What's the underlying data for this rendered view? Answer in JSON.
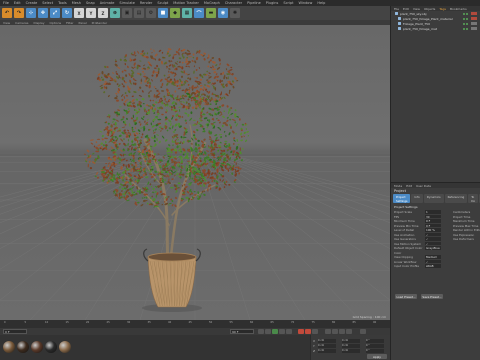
{
  "menubar": {
    "items": [
      "File",
      "Edit",
      "Create",
      "Select",
      "Tools",
      "Mesh",
      "Snap",
      "Animate",
      "Simulate",
      "Render",
      "Sculpt",
      "Motion Tracker",
      "MoGraph",
      "Character",
      "Pipeline",
      "Plugins",
      "Script",
      "Window",
      "Help"
    ]
  },
  "viewport": {
    "menus": [
      "View",
      "Cameras",
      "Display",
      "Options",
      "Filter",
      "Panel",
      "ProRender"
    ],
    "status": "Grid Spacing : 100 cm"
  },
  "object_manager": {
    "tabs": [
      "File",
      "Edit",
      "View",
      "Objects",
      "Tags",
      "Bookmarks"
    ],
    "active_tab": "Tags",
    "objects": [
      {
        "name": "plant_750_sky.obj",
        "tag_color": "#b24a3c"
      },
      {
        "name": "plant_750_foliage_Plant_material",
        "tag_color": "#b24a3c"
      },
      {
        "name": "Foliage_Plant_750",
        "tag_color": "#777777"
      },
      {
        "name": "plant_750_foliage_mat",
        "tag_color": "#777777"
      }
    ]
  },
  "attribute_manager": {
    "menus": [
      "Mode",
      "Edit",
      "User Data"
    ],
    "title": "Project",
    "tabs": [
      "Project Settings",
      "Info",
      "Dynamics",
      "Referencing",
      "To Do",
      "Key Interpolation"
    ],
    "section": "Project Settings",
    "rows": [
      {
        "label": "Project Scale",
        "value": "1",
        "right": "Centimeters"
      },
      {
        "label": "FPS",
        "value": "30",
        "right": "Project Time"
      },
      {
        "label": "Minimum Time",
        "value": "0 F",
        "right": "Maximum Time"
      },
      {
        "label": "Preview Min Time",
        "value": "0 F",
        "right": "Preview Max Time"
      },
      {
        "label": "Level of Detail",
        "value": "100 %",
        "right": "Render LOD in Editor"
      },
      {
        "label": "Use Animation",
        "value": "✓",
        "right": "Use Expression"
      },
      {
        "label": "Use Generators",
        "value": "✓",
        "right": "Use Deformers"
      },
      {
        "label": "Use Motion System",
        "value": "✓",
        "right": ""
      },
      {
        "label": "Default Object Color",
        "value": "Gray-Blue",
        "right": ""
      },
      {
        "label": "Color",
        "value": "",
        "right": ""
      },
      {
        "label": "View Clipping",
        "value": "Medium",
        "right": ""
      },
      {
        "label": "Linear Workflow",
        "value": "✓",
        "right": ""
      },
      {
        "label": "Input Color Profile",
        "value": "sRGB",
        "right": ""
      }
    ],
    "buttons": [
      "Load Preset...",
      "Save Preset..."
    ]
  },
  "timeline": {
    "ticks": [
      "0",
      "5",
      "10",
      "15",
      "20",
      "25",
      "30",
      "35",
      "40",
      "45",
      "50",
      "55",
      "60",
      "65",
      "70",
      "75",
      "80",
      "85",
      "90"
    ],
    "current": "0 F",
    "end": "90 F"
  },
  "coordinates": {
    "rows": [
      {
        "axis": "X",
        "pos": "0 cm",
        "size": "0 cm",
        "rot": "0 °"
      },
      {
        "axis": "Y",
        "pos": "0 cm",
        "size": "0 cm",
        "rot": "0 °"
      },
      {
        "axis": "Z",
        "pos": "0 cm",
        "size": "0 cm",
        "rot": "0 °"
      }
    ],
    "apply_label": "Apply"
  },
  "materials": [
    {
      "name": "mat1",
      "color": "#7a5a3a"
    },
    {
      "name": "mat2",
      "color": "#3d2b1e"
    },
    {
      "name": "mat3",
      "color": "#5b3a2a"
    },
    {
      "name": "mat4",
      "color": "#2a2a2a"
    },
    {
      "name": "mat5",
      "color": "#8a6a4a"
    }
  ],
  "colors": {
    "accent": "#4c8bc6",
    "tool_orange": "#d98c2b",
    "leaf_green": "#3f7a2a",
    "leaf_brown": "#8a4a2a",
    "basket": "#b8946a"
  }
}
